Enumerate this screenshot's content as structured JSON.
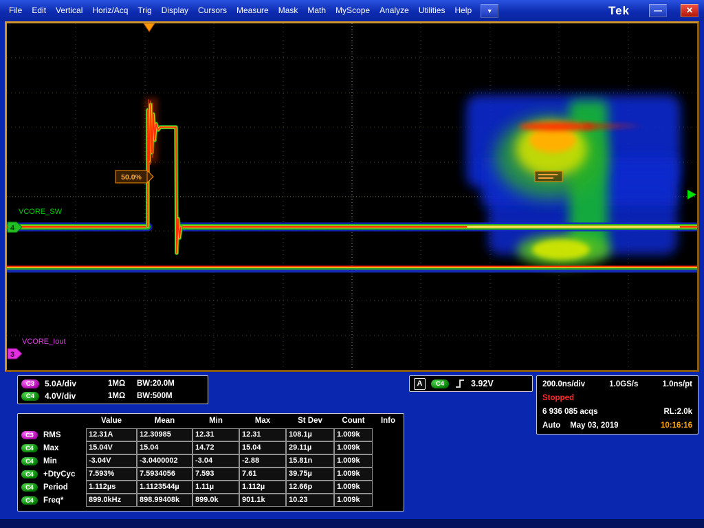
{
  "menu": {
    "items": [
      "File",
      "Edit",
      "Vertical",
      "Horiz/Acq",
      "Trig",
      "Display",
      "Cursors",
      "Measure",
      "Mask",
      "Math",
      "MyScope",
      "Analyze",
      "Utilities",
      "Help"
    ],
    "dropdown_icon": "▼",
    "logo": "Tek"
  },
  "window_controls": {
    "minimize_icon": "—",
    "close_icon": "✕"
  },
  "plot": {
    "trigger_position_label": "50.0%",
    "ch4_label": "VCORE_SW",
    "ch3_label": "VCORE_Iout",
    "ch4_marker": "4",
    "ch3_marker": "3"
  },
  "vertical_readouts": [
    {
      "badge": "C3",
      "scale": "5.0A/div",
      "coupling": "1MΩ",
      "bandwidth": "BW:20.0M"
    },
    {
      "badge": "C4",
      "scale": "4.0V/div",
      "coupling": "1MΩ",
      "bandwidth": "BW:500M"
    }
  ],
  "trigger_readout": {
    "system": "A",
    "source": "C4",
    "slope_icon": "rising-edge",
    "level": "3.92V"
  },
  "horizontal_readout": {
    "scale": "200.0ns/div",
    "sample_rate": "1.0GS/s",
    "resolution": "1.0ns/pt",
    "acq_state": "Stopped",
    "acq_count": "6 936 085 acqs",
    "record_length": "RL:2.0k",
    "trig_mode": "Auto",
    "date": "May 03, 2019",
    "time": "10:16:16"
  },
  "measurements": {
    "headers": [
      "Value",
      "Mean",
      "Min",
      "Max",
      "St Dev",
      "Count",
      "Info"
    ],
    "rows": [
      {
        "badge": "C3",
        "name": "RMS",
        "cells": [
          "12.31A",
          "12.30985",
          "12.31",
          "12.31",
          "108.1µ",
          "1.009k",
          ""
        ]
      },
      {
        "badge": "C4",
        "name": "Max",
        "cells": [
          "15.04V",
          "15.04",
          "14.72",
          "15.04",
          "29.11µ",
          "1.009k",
          ""
        ]
      },
      {
        "badge": "C4",
        "name": "Min",
        "cells": [
          "-3.04V",
          "-3.0400002",
          "-3.04",
          "-2.88",
          "15.81n",
          "1.009k",
          ""
        ]
      },
      {
        "badge": "C4",
        "name": "+DtyCyc",
        "cells": [
          "7.593%",
          "7.5934056",
          "7.593",
          "7.61",
          "39.75µ",
          "1.009k",
          ""
        ]
      },
      {
        "badge": "C4",
        "name": "Period",
        "cells": [
          "1.112µs",
          "1.1123544µ",
          "1.11µ",
          "1.112µ",
          "12.66p",
          "1.009k",
          ""
        ]
      },
      {
        "badge": "C4",
        "name": "Freq*",
        "cells": [
          "899.0kHz",
          "898.99408k",
          "899.0k",
          "901.1k",
          "10.23",
          "1.009k",
          ""
        ]
      }
    ]
  },
  "colors": {
    "c3": "#cc00cc",
    "c4": "#00aa00",
    "accent_orange": "#ff9000",
    "status_red": "#ff2a2a",
    "time_orange": "#ffa000"
  }
}
